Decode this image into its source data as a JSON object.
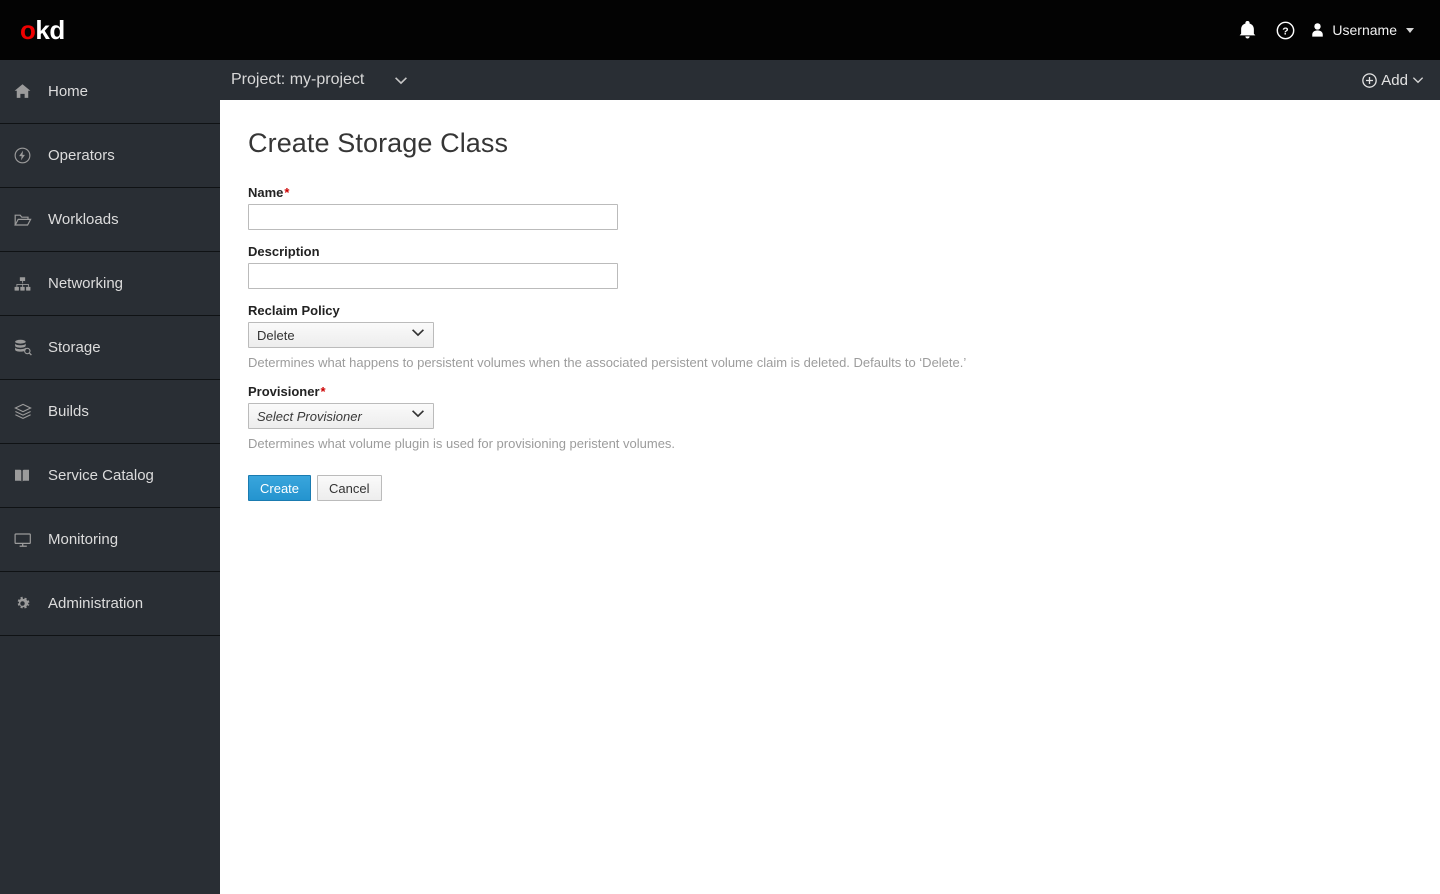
{
  "masthead": {
    "brand_o": "o",
    "brand_kd": "kd",
    "notifications_icon": "bell-icon",
    "help_icon": "help-circle-icon",
    "user_icon": "user-avatar-icon",
    "username": "Username"
  },
  "projectbar": {
    "project_label": "Project: my-project",
    "add_label": "Add"
  },
  "sidebar": {
    "items": [
      {
        "label": "Home",
        "icon": "home-icon"
      },
      {
        "label": "Operators",
        "icon": "operators-icon"
      },
      {
        "label": "Workloads",
        "icon": "folder-open-icon"
      },
      {
        "label": "Networking",
        "icon": "sitemap-icon"
      },
      {
        "label": "Storage",
        "icon": "database-search-icon"
      },
      {
        "label": "Builds",
        "icon": "layers-icon"
      },
      {
        "label": "Service Catalog",
        "icon": "book-icon"
      },
      {
        "label": "Monitoring",
        "icon": "monitor-icon"
      },
      {
        "label": "Administration",
        "icon": "gear-icon"
      }
    ]
  },
  "page": {
    "title": "Create Storage Class",
    "fields": {
      "name": {
        "label": "Name",
        "required_marker": "*",
        "value": "",
        "placeholder": ""
      },
      "description": {
        "label": "Description",
        "value": "",
        "placeholder": ""
      },
      "reclaim_policy": {
        "label": "Reclaim Policy",
        "value": "Delete",
        "help": "Determines what happens to persistent volumes when the associated persistent volume claim is deleted. Defaults to ‘Delete.’"
      },
      "provisioner": {
        "label": "Provisioner",
        "required_marker": "*",
        "value": "Select Provisioner",
        "help": "Determines what volume plugin is used for provisioning peristent volumes."
      }
    },
    "buttons": {
      "create": "Create",
      "cancel": "Cancel"
    }
  },
  "colors": {
    "masthead_bg": "#030303",
    "sidebar_bg": "#292e34",
    "sidebar_divider": "#0f1214",
    "content_bg": "#ffffff",
    "primary_button": "#2a9fd8",
    "required_asterisk": "#cc0000",
    "brand_accent": "#ee0000",
    "help_text": "#9c9c9c"
  }
}
